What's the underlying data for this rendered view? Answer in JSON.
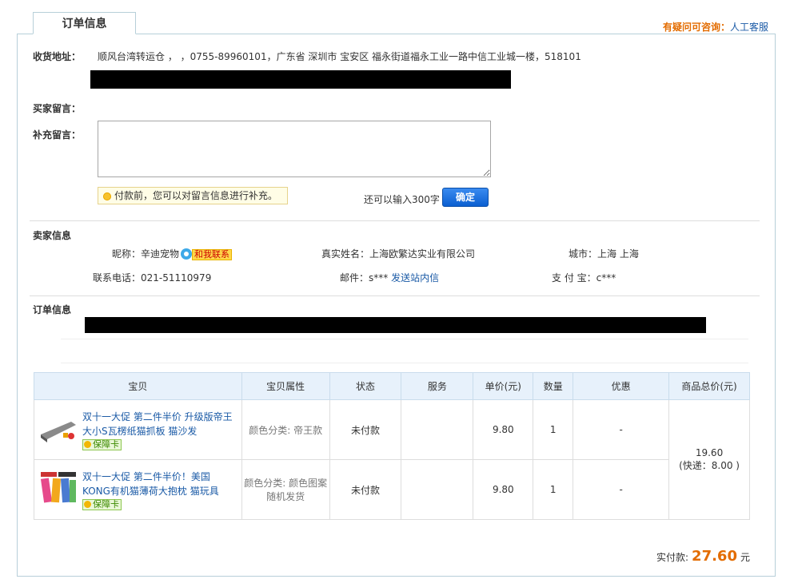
{
  "tab": {
    "title": "订单信息"
  },
  "help": {
    "question": "有疑问可咨询：",
    "link": "人工客服"
  },
  "shipping": {
    "label": "收货地址：",
    "address": "顺风台湾转运仓 ， ，0755-89960101，广东省 深圳市 宝安区 福永街道福永工业一路中信工业城一楼，518101"
  },
  "buyer_note": {
    "label": "买家留言："
  },
  "extra_note": {
    "label": "补充留言：",
    "value": "",
    "tip": "付款前，您可以对留言信息进行补充。",
    "remaining": "还可以输入300字",
    "confirm": "确定"
  },
  "seller": {
    "section_title": "卖家信息",
    "nickname_label": "昵称：",
    "nickname": "辛迪宠物",
    "contact_me": "和我联系",
    "realname_label": "真实姓名：",
    "realname": "上海欧繁达实业有限公司",
    "city_label": "城市：",
    "city": "上海 上海",
    "phone_label": "联系电话：",
    "phone": "021-51110979",
    "email_label": "邮件：",
    "email": "s***",
    "send_msg": "发送站内信",
    "alipay_label": "支 付 宝：",
    "alipay": "c***"
  },
  "order": {
    "section_title": "订单信息"
  },
  "table": {
    "headers": [
      "宝贝",
      "宝贝属性",
      "状态",
      "服务",
      "单价(元)",
      "数量",
      "优惠",
      "商品总价(元)"
    ],
    "rows": [
      {
        "title": "双十一大促 第二件半价 升级版帝王大小S瓦楞纸猫抓板 猫沙发",
        "badge": "保障卡",
        "attr": "颜色分类: 帝王款",
        "status": "未付款",
        "service": "",
        "price": "9.80",
        "qty": "1",
        "discount": "-"
      },
      {
        "title": "双十一大促 第二件半价！美国KONG有机猫薄荷大抱枕 猫玩具",
        "badge": "保障卡",
        "attr": "颜色分类: 颜色图案随机发货",
        "status": "未付款",
        "service": "",
        "price": "9.80",
        "qty": "1",
        "discount": "-"
      }
    ],
    "total": "19.60",
    "shipping_note": "(快递：8.00 )"
  },
  "payment": {
    "label": "实付款:",
    "amount": "27.60",
    "unit": "元"
  },
  "colors": {
    "accent": "#e36c00",
    "link": "#1a5aa6",
    "border": "#b7cfd9"
  }
}
